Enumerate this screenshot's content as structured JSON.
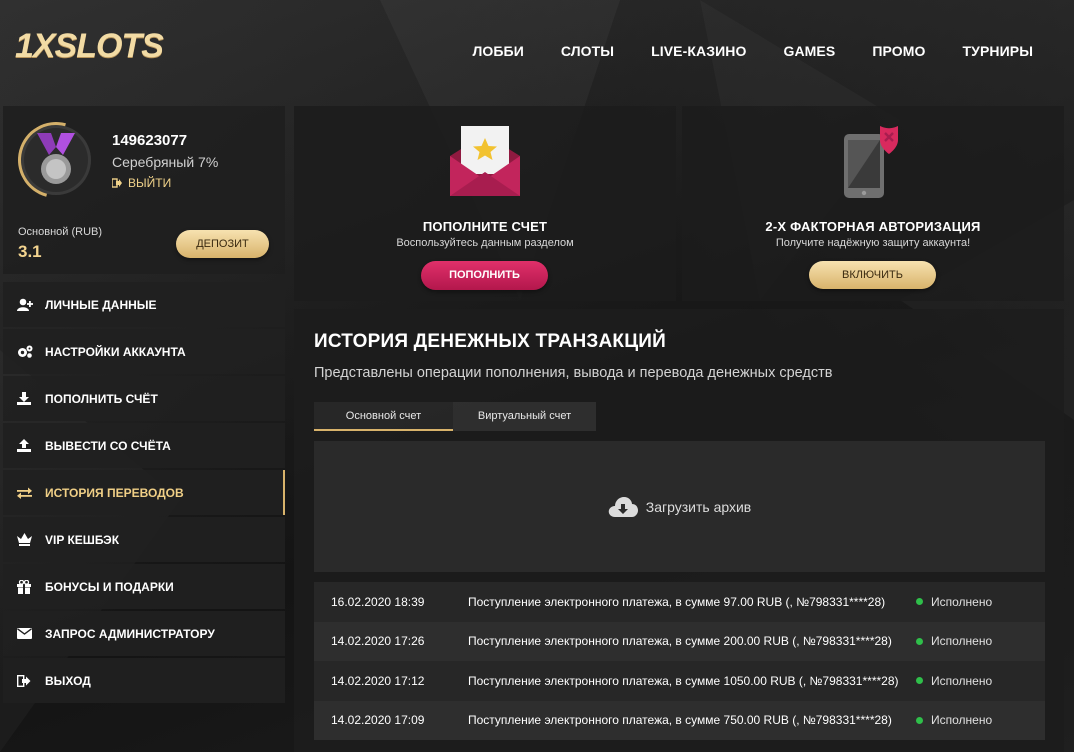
{
  "header": {
    "logo_text": "1XSLOTS",
    "nav": [
      "ЛОББИ",
      "СЛОТЫ",
      "LIVE-КАЗИНО",
      "GAMES",
      "ПРОМО",
      "ТУРНИРЫ"
    ]
  },
  "profile": {
    "user_id": "149623077",
    "level": "Серебряный 7%",
    "logout_label": "ВЫЙТИ",
    "balance_label": "Основной (RUB)",
    "balance_value": "3.1",
    "deposit_label": "ДЕПОЗИТ"
  },
  "menu": [
    {
      "label": "ЛИЧНЫЕ ДАННЫЕ",
      "icon": "user-add-icon"
    },
    {
      "label": "НАСТРОЙКИ АККАУНТА",
      "icon": "gears-icon"
    },
    {
      "label": "ПОПОЛНИТЬ СЧЁТ",
      "icon": "download-icon"
    },
    {
      "label": "ВЫВЕСТИ СО СЧЁТА",
      "icon": "upload-icon"
    },
    {
      "label": "ИСТОРИЯ ПЕРЕВОДОВ",
      "icon": "transfer-icon",
      "active": true
    },
    {
      "label": "VIP КЕШБЭК",
      "icon": "crown-icon"
    },
    {
      "label": "БОНУСЫ И ПОДАРКИ",
      "icon": "gift-icon"
    },
    {
      "label": "ЗАПРОС АДМИНИСТРАТОРУ",
      "icon": "envelope-icon"
    },
    {
      "label": "ВЫХОД",
      "icon": "logout-icon"
    }
  ],
  "cards": {
    "deposit": {
      "title": "ПОПОЛНИТЕ СЧЕТ",
      "subtitle": "Воспользуйтесь данным разделом",
      "button": "ПОПОЛНИТЬ"
    },
    "twofa": {
      "title": "2-Х ФАКТОРНАЯ АВТОРИЗАЦИЯ",
      "subtitle": "Получите надёжную защиту аккаунта!",
      "button": "ВКЛЮЧИТЬ"
    }
  },
  "history": {
    "title": "ИСТОРИЯ ДЕНЕЖНЫХ ТРАНЗАКЦИЙ",
    "subtitle": "Представлены операции пополнения, вывода и перевода денежных средств",
    "tabs": [
      "Основной счет",
      "Виртуальный счет"
    ],
    "archive_label": "Загрузить архив",
    "rows": [
      {
        "date": "16.02.2020 18:39",
        "desc": "Поступление электронного платежа, в сумме 97.00 RUB (, №798331****28)",
        "status": "Исполнено"
      },
      {
        "date": "14.02.2020 17:26",
        "desc": "Поступление электронного платежа, в сумме 200.00 RUB (, №798331****28)",
        "status": "Исполнено"
      },
      {
        "date": "14.02.2020 17:12",
        "desc": "Поступление электронного платежа, в сумме 1050.00 RUB (, №798331****28)",
        "status": "Исполнено"
      },
      {
        "date": "14.02.2020 17:09",
        "desc": "Поступление электронного платежа, в сумме 750.00 RUB (, №798331****28)",
        "status": "Исполнено"
      }
    ]
  },
  "colors": {
    "accent_gold": "#d8b36b",
    "accent_pink": "#c91f58",
    "status_green": "#2fbf4a"
  }
}
